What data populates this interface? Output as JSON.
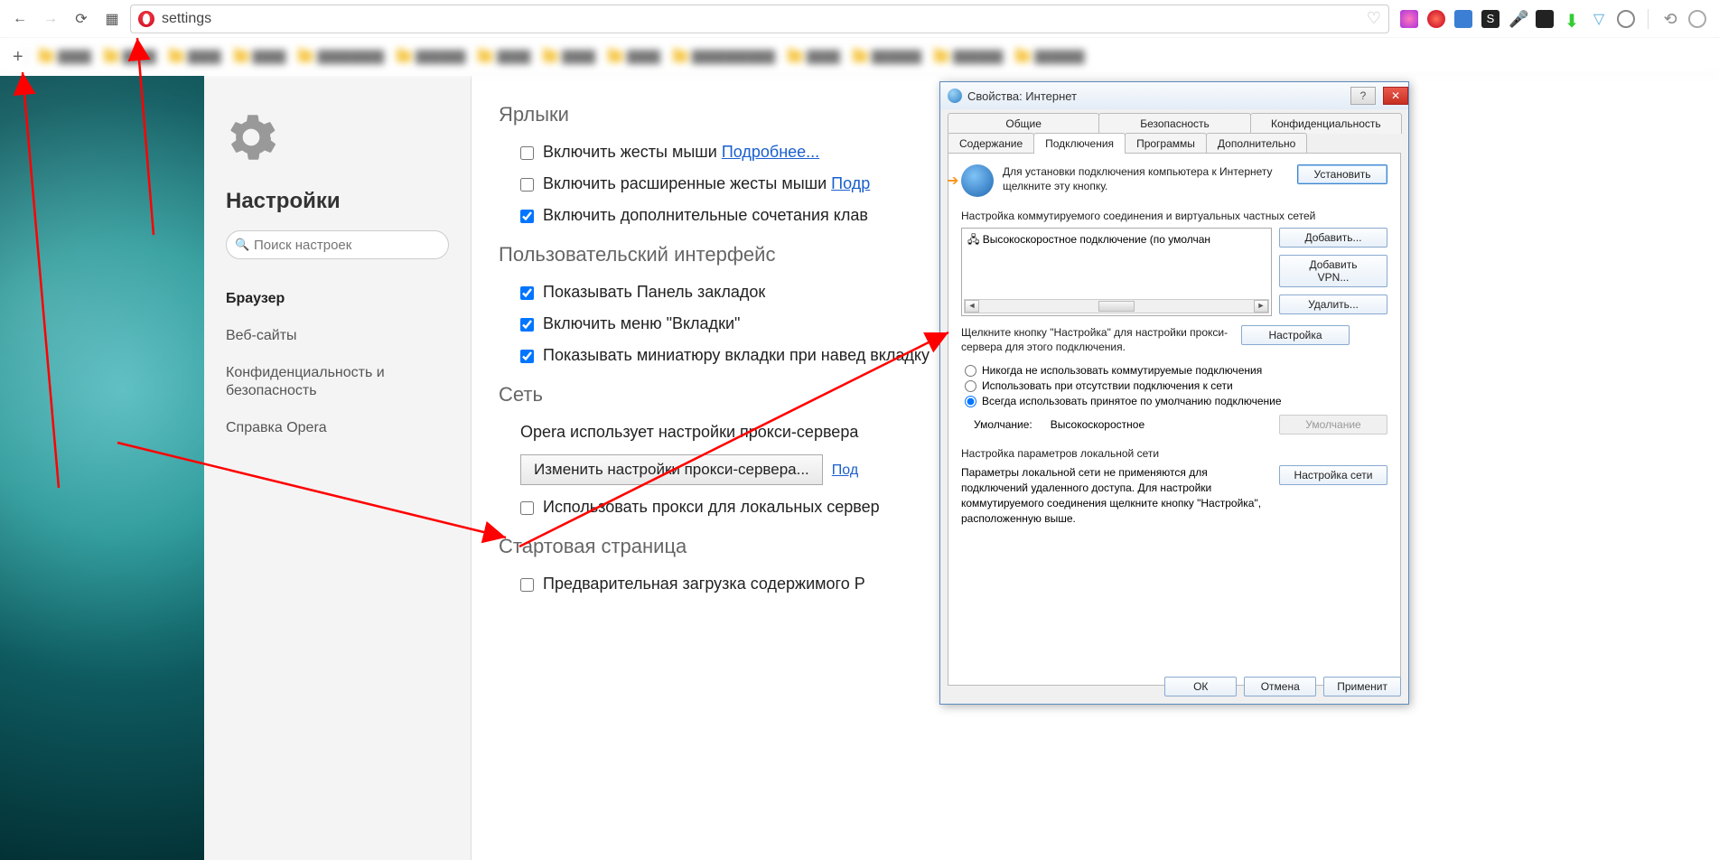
{
  "toolbar": {
    "address": "settings"
  },
  "sidebar": {
    "title": "Настройки",
    "search_placeholder": "Поиск настроек",
    "nav": [
      "Браузер",
      "Веб-сайты",
      "Конфиденциальность и безопасность",
      "Справка Opera"
    ]
  },
  "settings": {
    "s1_title": "Ярлыки",
    "s1_o1": "Включить жесты мыши",
    "s1_o1_link": "Подробнее...",
    "s1_o2": "Включить расширенные жесты мыши",
    "s1_o2_link": "Подр",
    "s1_o3": "Включить дополнительные сочетания клав",
    "s2_title": "Пользовательский интерфейс",
    "s2_o1": "Показывать Панель закладок",
    "s2_o2": "Включить меню \"Вкладки\"",
    "s2_o3": "Показывать миниатюру вкладки при навед           вкладку",
    "s3_title": "Сеть",
    "s3_text": "Opera использует настройки прокси-сервера",
    "s3_btn": "Изменить настройки прокси-сервера...",
    "s3_link": "Под",
    "s3_o1": "Использовать прокси для локальных сервер",
    "s4_title": "Стартовая страница",
    "s4_o1": "Предварительная загрузка содержимого Р"
  },
  "dialog": {
    "title": "Свойства: Интернет",
    "tabs_row1": [
      "Общие",
      "Безопасность",
      "Конфиденциальность"
    ],
    "tabs_row2": [
      "Содержание",
      "Подключения",
      "Программы",
      "Дополнительно"
    ],
    "setup_text": "Для установки подключения компьютера к Интернету щелкните эту кнопку.",
    "setup_btn": "Установить",
    "group1": "Настройка коммутируемого соединения и виртуальных частных сетей",
    "conn_item": "Высокоскоростное подключение (по умолчан",
    "btn_add": "Добавить...",
    "btn_vpn": "Добавить VPN...",
    "btn_del": "Удалить...",
    "btn_cfg": "Настройка",
    "hint1": "Щелкните кнопку \"Настройка\" для настройки прокси-сервера для этого подключения.",
    "r1": "Никогда не использовать коммутируемые подключения",
    "r2": "Использовать при отсутствии подключения к сети",
    "r3": "Всегда использовать принятое по умолчанию подключение",
    "def_lbl": "Умолчание:",
    "def_val": "Высокоскоростное",
    "def_btn": "Умолчание",
    "group2": "Настройка параметров локальной сети",
    "lan_text": "Параметры локальной сети не применяются для подключений удаленного доступа. Для настройки коммутируемого соединения щелкните кнопку \"Настройка\", расположенную выше.",
    "lan_btn": "Настройка сети",
    "ok": "ОК",
    "cancel": "Отмена",
    "apply": "Применит"
  }
}
